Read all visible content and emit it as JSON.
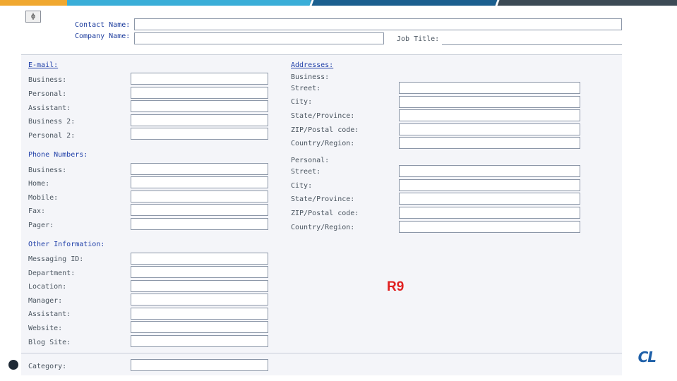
{
  "header": {
    "pin_glyph": "ф",
    "contact_name_label": "Contact Name:",
    "company_name_label": "Company Name:",
    "job_title_label": "Job Title:"
  },
  "email": {
    "title": "E-mail:",
    "fields": [
      "Business:",
      "Personal:",
      "Assistant:",
      "Business 2:",
      "Personal 2:"
    ]
  },
  "phone": {
    "title": "Phone Numbers:",
    "fields": [
      "Business:",
      "Home:",
      "Mobile:",
      "Fax:",
      "Pager:"
    ]
  },
  "other": {
    "title": "Other Information:",
    "fields": [
      "Messaging ID:",
      "Department:",
      "Location:",
      "Manager:",
      "Assistant:",
      "Website:",
      "Blog Site:"
    ]
  },
  "addresses": {
    "title": "Addresses:",
    "business": {
      "title": "Business:",
      "fields": [
        "Street:",
        "City:",
        "State/Province:",
        "ZIP/Postal code:",
        "Country/Region:"
      ]
    },
    "personal": {
      "title": "Personal:",
      "fields": [
        "Street:",
        "City:",
        "State/Province:",
        "ZIP/Postal code:",
        "Country/Region:"
      ]
    }
  },
  "category": {
    "label": "Category:"
  },
  "annotation": {
    "text": "R9"
  },
  "brand": {
    "text": "CL"
  },
  "colors": {
    "bar_orange": "#f0a830",
    "bar_cyan": "#3aaed8",
    "bar_blue": "#1b5f8f",
    "bar_slate": "#3c4a55",
    "annotation_red": "#e02020",
    "section_title_blue": "#1f3fa8"
  }
}
